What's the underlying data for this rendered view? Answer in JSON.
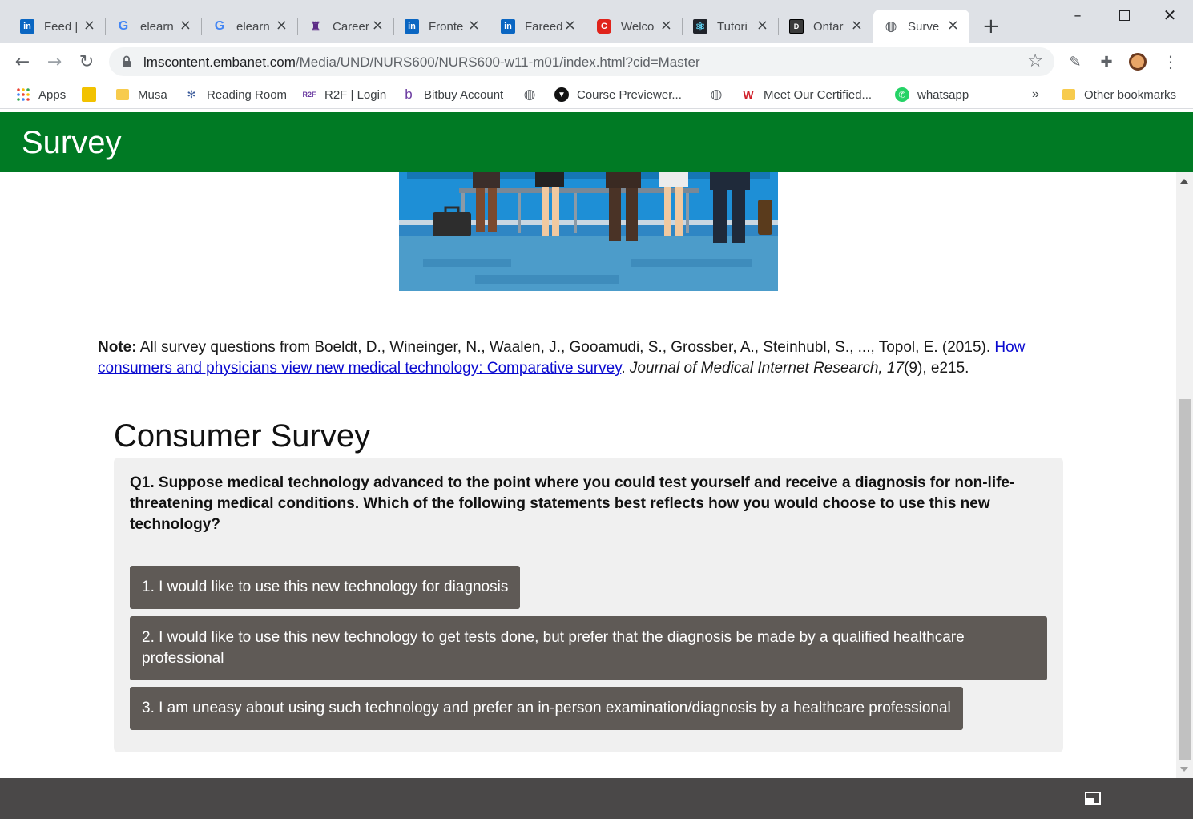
{
  "tabs": [
    {
      "title": "Feed |",
      "icon": "linkedin-icon",
      "color": "#0a66c2",
      "glyph": "in"
    },
    {
      "title": "elearn",
      "icon": "google-icon",
      "color": "#ffffff",
      "glyph": "G"
    },
    {
      "title": "elearn",
      "icon": "google-icon",
      "color": "#ffffff",
      "glyph": "G"
    },
    {
      "title": "Career",
      "icon": "university-crest-icon",
      "color": "#5b2a86",
      "glyph": "♜"
    },
    {
      "title": "Fronte",
      "icon": "linkedin-icon",
      "color": "#0a66c2",
      "glyph": "in"
    },
    {
      "title": "Fareed",
      "icon": "linkedin-icon",
      "color": "#0a66c2",
      "glyph": "in"
    },
    {
      "title": "Welco",
      "icon": "c-logo-icon",
      "color": "#e0231b",
      "glyph": "C"
    },
    {
      "title": "Tutori",
      "icon": "react-icon",
      "color": "#20232a",
      "glyph": "⚛"
    },
    {
      "title": "Ontar",
      "icon": "dms-icon",
      "color": "#3a3a3a",
      "glyph": "D"
    },
    {
      "title": "Surve",
      "icon": "globe-icon",
      "color": "#5f6368",
      "glyph": "◍",
      "active": true
    }
  ],
  "address_bar": {
    "host": "lmscontent.embanet.com",
    "path": "/Media/UND/NURS600/NURS600-w11-m01/index.html?cid=Master"
  },
  "bookmarks": {
    "apps": "Apps",
    "musa": "Musa",
    "reading_room": "Reading Room",
    "r2f": "R2F | Login",
    "bitbuy": "Bitbuy Account",
    "course_previewer": "Course Previewer...",
    "meet_certified": "Meet Our Certified...",
    "whatsapp": "whatsapp",
    "overflow": "»",
    "other": "Other bookmarks"
  },
  "page": {
    "header_title": "Survey",
    "note_label": "Note:",
    "note_text": " All survey questions from Boeldt, D., Wineinger, N., Waalen, J., Gooamudi, S., Grossber, A., Steinhubl, S., ..., Topol, E. (2015). ",
    "note_link": "How consumers and physicians view new medical technology: Comparative survey",
    "note_after_link": ". ",
    "note_journal": "Journal of Medical Internet Research, 17",
    "note_issue": "(9), e215.",
    "survey_title": "Consumer Survey",
    "question": "Q1. Suppose medical technology advanced to the point where you could test yourself and receive a diagnosis for non-life-threatening medical conditions. Which of the following statements best reflects how you would choose to use this new technology?",
    "options": [
      "1. I would like to use this new technology for diagnosis",
      "2. I would like to use this new technology to get tests done, but prefer that the diagnosis be made by a qualified healthcare professional",
      "3. I am uneasy about using such technology and prefer an in-person examination/diagnosis by a healthcare professional"
    ]
  },
  "colors": {
    "header_green": "#007a24",
    "option_bg": "#5f5a56",
    "card_bg": "#f0f0f0",
    "footer_bg": "#4a4848",
    "link_blue": "#0a0ad0"
  }
}
